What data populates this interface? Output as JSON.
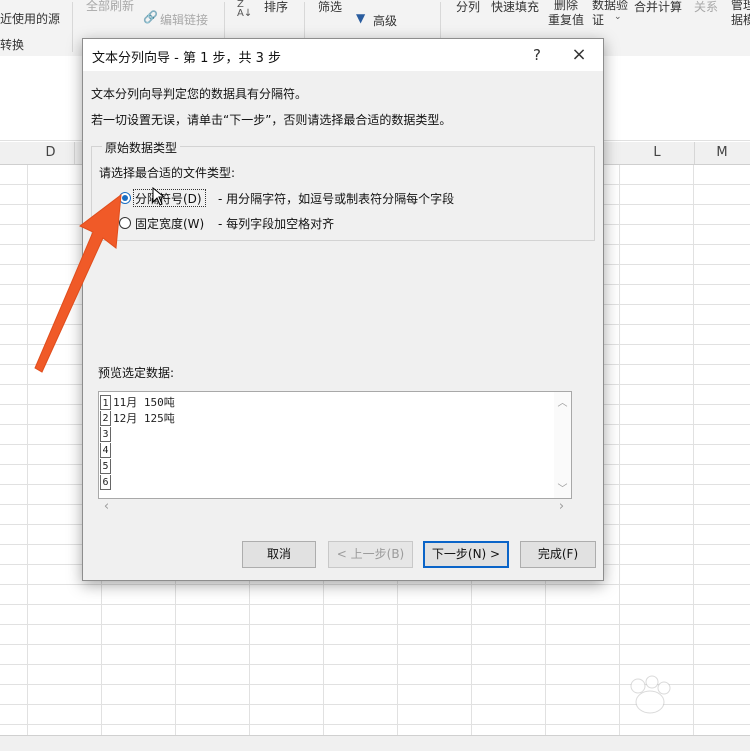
{
  "ribbon": {
    "recent_source": "近使用的源",
    "convert": "转换",
    "refresh_all": "全部刷新",
    "edit_links": "编辑链接",
    "sort": "排序",
    "filter": "筛选",
    "advanced": "高级",
    "text_to_columns": "分列",
    "flash_fill": "快速填充",
    "remove_duplicates": "删除\n重复值",
    "data_validation": "数据验\n证",
    "consolidate": "合并计算",
    "relationships": "关系",
    "manage": "管理\n据模"
  },
  "columns": [
    "D",
    "L",
    "M"
  ],
  "dialog": {
    "title": "文本分列向导 - 第 1 步，共 3 步",
    "help": "?",
    "close": "×",
    "intro1": "文本分列向导判定您的数据具有分隔符。",
    "intro2": "若一切设置无误，请单击“下一步”，否则请选择最合适的数据类型。",
    "group_title": "原始数据类型",
    "group_prompt": "请选择最合适的文件类型:",
    "options": [
      {
        "label": "分隔符号(D)",
        "desc": "- 用分隔字符，如逗号或制表符分隔每个字段",
        "selected": true
      },
      {
        "label": "固定宽度(W)",
        "desc": "- 每列字段加空格对齐",
        "selected": false
      }
    ],
    "preview_label": "预览选定数据:",
    "preview_rows": [
      {
        "num": "1",
        "text": "11月 150吨"
      },
      {
        "num": "2",
        "text": "12月 125吨"
      },
      {
        "num": "3",
        "text": ""
      },
      {
        "num": "4",
        "text": ""
      },
      {
        "num": "5",
        "text": ""
      },
      {
        "num": "6",
        "text": ""
      }
    ],
    "buttons": {
      "cancel": "取消",
      "back": "< 上一步(B)",
      "next": "下一步(N) >",
      "finish": "完成(F)"
    }
  },
  "colors": {
    "accent": "#1b6ec2",
    "arrow": "#f05a28"
  },
  "icons": [
    "sort-az-icon",
    "filter-advanced-icon",
    "edit-links-icon",
    "chevron-up-icon",
    "chevron-down-icon",
    "chevron-left-icon",
    "chevron-right-icon",
    "close-icon",
    "help-icon"
  ]
}
